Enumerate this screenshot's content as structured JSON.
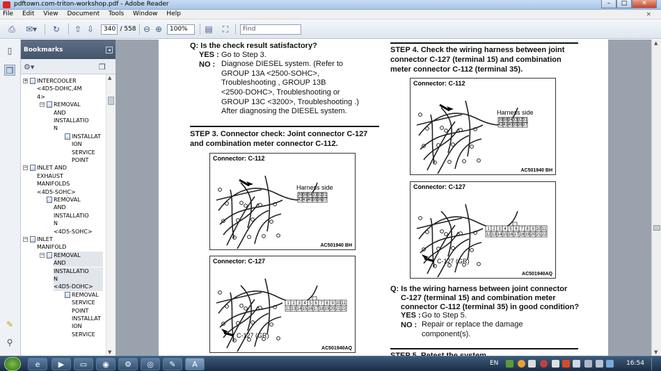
{
  "window": {
    "title": "pdftown.com-triton-workshop.pdf - Adobe Reader",
    "minimize": "–",
    "maximize": "□",
    "close": "✕"
  },
  "menu": {
    "items": [
      "File",
      "Edit",
      "View",
      "Document",
      "Tools",
      "Window",
      "Help"
    ],
    "close_doc": "×"
  },
  "toolbar": {
    "current_page": "340",
    "total_pages": "/ 558",
    "zoom": "100%",
    "find_placeholder": "Find"
  },
  "bookmarks": {
    "title": "Bookmarks",
    "items": [
      {
        "label": "INTERCOOLER",
        "level": 1,
        "toggle": "+"
      },
      {
        "label": "<4D5-DOHC,4M",
        "level": 1
      },
      {
        "label": "4>",
        "level": 1
      },
      {
        "label": "REMOVAL",
        "level": 2,
        "toggle": "−"
      },
      {
        "label": "AND",
        "level": 2
      },
      {
        "label": "INSTALLATIO",
        "level": 2
      },
      {
        "label": "N",
        "level": 2
      },
      {
        "label": "INSTALLAT",
        "level": 3
      },
      {
        "label": "ION",
        "level": 3
      },
      {
        "label": "SERVICE",
        "level": 3
      },
      {
        "label": "POINT",
        "level": 3
      },
      {
        "label": "INLET AND",
        "level": 1,
        "toggle": "−"
      },
      {
        "label": "EXHAUST",
        "level": 1
      },
      {
        "label": "MANIFOLDS",
        "level": 1
      },
      {
        "label": "<4D5-SOHC>",
        "level": 1
      },
      {
        "label": "REMOVAL",
        "level": 2
      },
      {
        "label": "AND",
        "level": 2
      },
      {
        "label": "INSTALLATIO",
        "level": 2
      },
      {
        "label": "N",
        "level": 2
      },
      {
        "label": "<4D5-SOHC>",
        "level": 2
      },
      {
        "label": "INLET",
        "level": 1,
        "toggle": "−"
      },
      {
        "label": "MANIFOLD",
        "level": 1
      },
      {
        "label": "REMOVAL",
        "level": 2,
        "toggle": "−",
        "selected": true
      },
      {
        "label": "AND",
        "level": 2,
        "selected": true
      },
      {
        "label": "INSTALLATIO",
        "level": 2,
        "selected": true
      },
      {
        "label": "N",
        "level": 2,
        "selected": true
      },
      {
        "label": "<4D5-DOHC>",
        "level": 2,
        "selected": true
      },
      {
        "label": "REMOVAL",
        "level": 3
      },
      {
        "label": "SERVICE",
        "level": 3
      },
      {
        "label": "POINT",
        "level": 3
      },
      {
        "label": "INSTALLAT",
        "level": 3
      },
      {
        "label": "ION",
        "level": 3
      },
      {
        "label": "SERVICE",
        "level": 3
      }
    ]
  },
  "page": {
    "left": {
      "q1": "Q: Is the check result satisfactory?",
      "yes_label": "YES :",
      "yes_text": "Go to Step 3.",
      "no_label": "NO :",
      "no_lines": [
        "Diagnose DIESEL system. (Refer to",
        "GROUP 13A <2500-SOHC>,",
        "Troubleshooting , GROUP 13B",
        "<2500-DOHC>, Troubleshooting  or",
        "GROUP 13C <3200>, Troubleshooting .)",
        "After diagnosing the DIESEL system."
      ],
      "step3_lines": [
        "STEP 3. Connector check: Joint connector C-127",
        "and combination meter connector C-112."
      ],
      "connA": {
        "label": "Connector: C-112",
        "side": "Harness side",
        "code": "AC501940 BH",
        "row1": [
          "39",
          "38",
          "34",
          "33",
          "32",
          "31"
        ],
        "row2": [
          "42",
          "41",
          "40",
          "35",
          "36",
          "37"
        ]
      },
      "connB": {
        "label": "Connector: C-127",
        "tag": "C-127 (GR)",
        "code": "AC501940AQ",
        "row1": [
          "1",
          "2",
          "3",
          "4",
          "5",
          "6",
          "7",
          "8",
          "9",
          "10",
          "11"
        ],
        "row2": [
          "12",
          "13",
          "14",
          "15",
          "16",
          "17",
          "18",
          "19",
          "20",
          "21",
          "22"
        ]
      }
    },
    "right": {
      "step4_lines": [
        "STEP 4. Check the wiring harness between joint",
        "connector C-127 (terminal 15) and combination",
        "meter connector C-112 (terminal 35)."
      ],
      "connA": {
        "label": "Connector: C-112",
        "side": "Harness side",
        "code": "AC501940 BH",
        "row1": [
          "39",
          "38",
          "34",
          "33",
          "32",
          "31"
        ],
        "row2": [
          "42",
          "41",
          "40",
          "35",
          "36",
          "37"
        ]
      },
      "connB": {
        "label": "Connector: C-127",
        "tag": "C-127 (GR)",
        "code": "AC501940AQ",
        "row1": [
          "1",
          "2",
          "3",
          "4",
          "5",
          "6",
          "7",
          "8",
          "9",
          "10",
          "11"
        ],
        "row2": [
          "12",
          "13",
          "14",
          "15",
          "16",
          "17",
          "18",
          "19",
          "20",
          "21",
          "22"
        ]
      },
      "q_lines": [
        "Q: Is the wiring harness between joint connector",
        "C-127 (terminal 15) and combination meter",
        "connector C-112 (terminal 35) in good condition?"
      ],
      "yes_label": "YES :",
      "yes_text": "Go to Step 5.",
      "no_label": "NO :",
      "no_lines": [
        "Repair or replace the damage",
        "component(s)."
      ],
      "step5": "STEP 5. Retest the system."
    }
  },
  "taskbar": {
    "language": "EN",
    "time": "16:54"
  }
}
